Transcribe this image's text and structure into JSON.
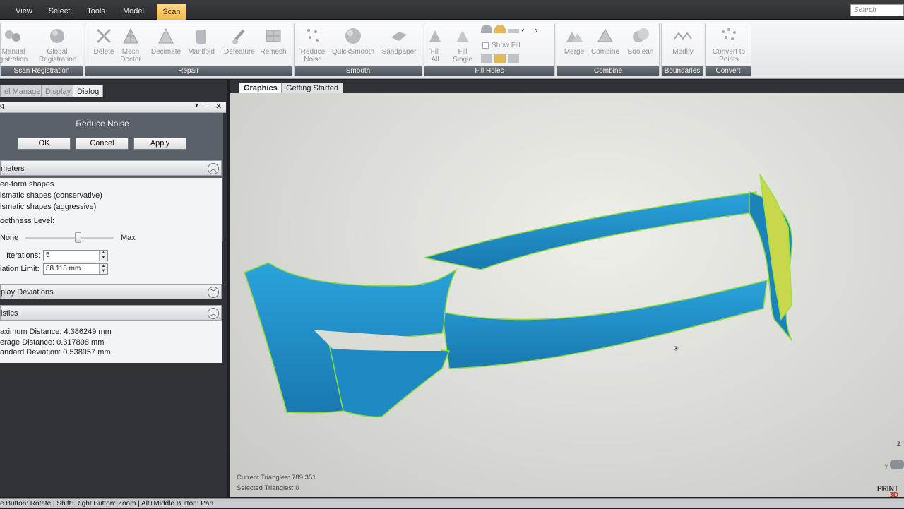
{
  "menu": {
    "items": [
      "View",
      "Select",
      "Tools",
      "Model",
      "Scan"
    ],
    "active": "Scan",
    "search_placeholder": "Search"
  },
  "ribbon": {
    "groups": [
      {
        "label": "Scan Registration",
        "buttons": [
          "Manual Registration",
          "Global Registration"
        ]
      },
      {
        "label": "Repair",
        "buttons": [
          "Delete",
          "Mesh Doctor",
          "Decimate",
          "Manifold",
          "Defeature",
          "Remesh"
        ]
      },
      {
        "label": "Smooth",
        "buttons": [
          "Reduce Noise",
          "QuickSmooth",
          "Sandpaper"
        ]
      },
      {
        "label": "Fill Holes",
        "buttons": [
          "Fill All",
          "Fill Single"
        ],
        "checkbox": "Show Fill"
      },
      {
        "label": "Combine",
        "buttons": [
          "Merge",
          "Combine",
          "Boolean"
        ]
      },
      {
        "label": "Boundaries",
        "buttons": [
          "Modify"
        ]
      },
      {
        "label": "Convert",
        "buttons": [
          "Convert to Points"
        ]
      }
    ],
    "manual_line1": "Manual",
    "manual_line2": "gistration",
    "global_line1": "Global",
    "global_line2": "Registration",
    "group_scan_label": "Scan Registration",
    "delete": "Delete",
    "mesh1": "Mesh",
    "mesh2": "Doctor",
    "decimate": "Decimate",
    "manifold": "Manifold",
    "defeature": "Defeature",
    "remesh": "Remesh",
    "group_repair_label": "Repair",
    "reduce1": "Reduce",
    "reduce2": "Noise",
    "quicksmooth": "QuickSmooth",
    "sandpaper": "Sandpaper",
    "group_smooth_label": "Smooth",
    "fill1": "Fill",
    "fill2": "All",
    "fills1": "Fill",
    "fills2": "Single",
    "show_fill": "Show Fill",
    "group_fill_label": "Fill Holes",
    "merge": "Merge",
    "combine": "Combine",
    "boolean": "Boolean",
    "group_combine_label": "Combine",
    "modify": "Modify",
    "group_boundaries_label": "Boundaries",
    "convert1": "Convert to",
    "convert2": "Points",
    "group_convert_label": "Convert"
  },
  "left_panel": {
    "tabs": [
      "el Manager",
      "Display",
      "Dialog"
    ],
    "active_tab": "Dialog",
    "titlebar": "g",
    "dialog_title": "Reduce Noise",
    "ok": "OK",
    "cancel": "Cancel",
    "apply": "Apply",
    "parameters_header": "meters",
    "options": [
      "ee-form shapes",
      "ismatic shapes (conservative)",
      "ismatic shapes (aggressive)"
    ],
    "smoothness_label": "oothness Level:",
    "slider_min": "None",
    "slider_max": "Max",
    "smoothness_value": 0.6,
    "iterations_label": "Iterations:",
    "iterations_value": "5",
    "deviation_label": "iation Limit:",
    "deviation_value": "88.118 mm",
    "display_deviations_header": "play Deviations",
    "statistics_header": "istics",
    "stat_max": "aximum Distance: 4.386249 mm",
    "stat_avg": "erage Distance: 0.317898 mm",
    "stat_std": "andard Deviation: 0.538957 mm"
  },
  "graphics": {
    "tabs": [
      "Graphics",
      "Getting Started"
    ],
    "active_tab": "Graphics",
    "current_triangles": "Current Triangles: 789,351",
    "selected_triangles": "Selected Triangles: 0",
    "axis_z": "Z",
    "axis_y": "Y"
  },
  "status": "e Button: Rotate | Shift+Right Button: Zoom | Alt+Middle Button: Pan",
  "logo_top": "PRINT",
  "logo_bottom": "3D",
  "colors": {
    "mesh": "#1f8fc8",
    "accent_tab": "#f2b847",
    "mesh_edge": "#9be040",
    "mesh_highlight": "#c7d944"
  }
}
